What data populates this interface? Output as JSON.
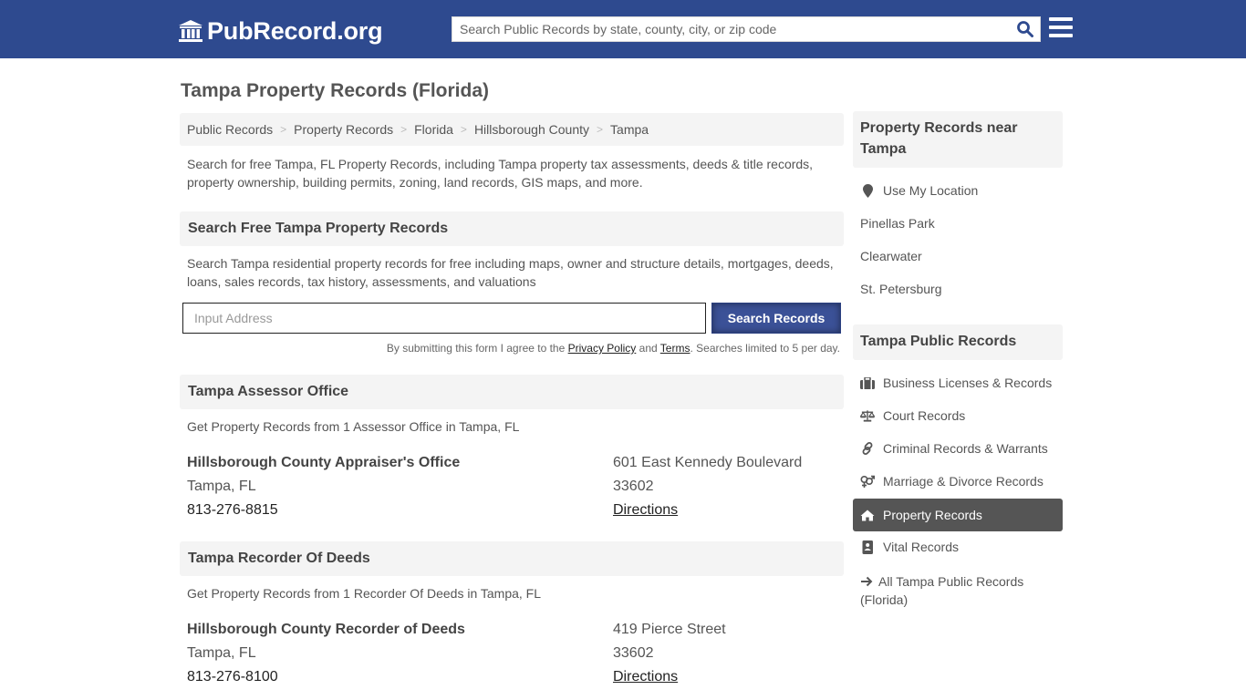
{
  "header": {
    "logo_text": "PubRecord.org",
    "search_placeholder": "Search Public Records by state, county, city, or zip code",
    "brand_color": "#2e4a8f"
  },
  "page": {
    "title": "Tampa Property Records (Florida)",
    "breadcrumb": [
      "Public Records",
      "Property Records",
      "Florida",
      "Hillsborough County",
      "Tampa"
    ],
    "intro": "Search for free Tampa, FL Property Records, including Tampa property tax assessments, deeds & title records, property ownership, building permits, zoning, land records, GIS maps, and more."
  },
  "search_section": {
    "heading": "Search Free Tampa Property Records",
    "description": "Search Tampa residential property records for free including maps, owner and structure details, mortgages, deeds, loans, sales records, tax history, assessments, and valuations",
    "input_placeholder": "Input Address",
    "button_label": "Search Records",
    "disclaimer_prefix": "By submitting this form I agree to the ",
    "privacy_label": "Privacy Policy",
    "and_text": " and ",
    "terms_label": "Terms",
    "disclaimer_suffix": ". Searches limited to 5 per day."
  },
  "offices": [
    {
      "heading": "Tampa Assessor Office",
      "description": "Get Property Records from 1 Assessor Office in Tampa, FL",
      "name": "Hillsborough County Appraiser's Office",
      "city": "Tampa, FL",
      "phone": "813-276-8815",
      "street": "601 East Kennedy Boulevard",
      "zip": "33602",
      "directions_label": "Directions"
    },
    {
      "heading": "Tampa Recorder Of Deeds",
      "description": "Get Property Records from 1 Recorder Of Deeds in Tampa, FL",
      "name": "Hillsborough County Recorder of Deeds",
      "city": "Tampa, FL",
      "phone": "813-276-8100",
      "street": "419 Pierce Street",
      "zip": "33602",
      "directions_label": "Directions"
    }
  ],
  "sidebar": {
    "nearby_heading": "Property Records near Tampa",
    "use_location": "Use My Location",
    "nearby": [
      "Pinellas Park",
      "Clearwater",
      "St. Petersburg"
    ],
    "public_heading": "Tampa Public Records",
    "links": [
      {
        "label": "Business Licenses & Records",
        "icon": "briefcase-icon"
      },
      {
        "label": "Court Records",
        "icon": "scales-icon"
      },
      {
        "label": "Criminal Records & Warrants",
        "icon": "link-icon"
      },
      {
        "label": "Marriage & Divorce Records",
        "icon": "gender-icon"
      },
      {
        "label": "Property Records",
        "icon": "home-icon",
        "active": true
      },
      {
        "label": "Vital Records",
        "icon": "address-book-icon"
      }
    ],
    "all_records": "All Tampa Public Records (Florida)"
  }
}
